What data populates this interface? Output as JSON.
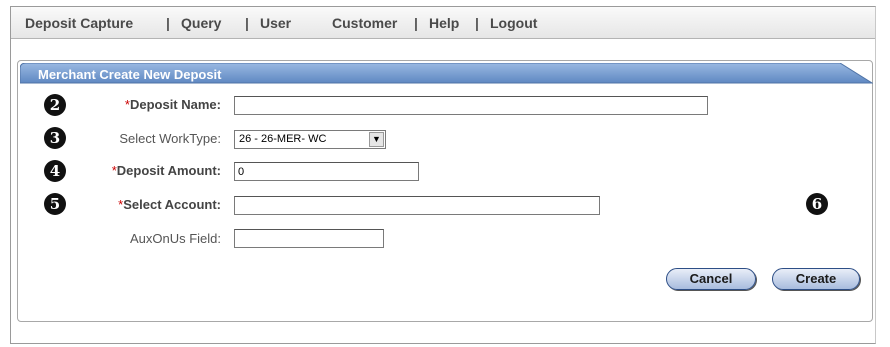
{
  "nav": {
    "items": [
      "Deposit Capture",
      "Query",
      "User",
      "Customer",
      "Help",
      "Logout"
    ],
    "separator": "|"
  },
  "form": {
    "title": "Merchant Create New Deposit",
    "required_marker": "*",
    "fields": {
      "deposit_name": {
        "label": "Deposit Name:",
        "value": ""
      },
      "worktype": {
        "label": "Select WorkType:",
        "value": "26 - 26-MER- WC"
      },
      "deposit_amount": {
        "label": "Deposit Amount:",
        "value": "0"
      },
      "select_account": {
        "label": "Select Account:",
        "value": ""
      },
      "auxonus": {
        "label": "AuxOnUs Field:",
        "value": ""
      }
    },
    "buttons": {
      "cancel": "Cancel",
      "create": "Create"
    }
  },
  "callouts": [
    "2",
    "3",
    "4",
    "5",
    "6"
  ],
  "colors": {
    "tab_blue": "#6f96cc",
    "required_red": "#cc0000",
    "button_border": "#2d4e86"
  }
}
